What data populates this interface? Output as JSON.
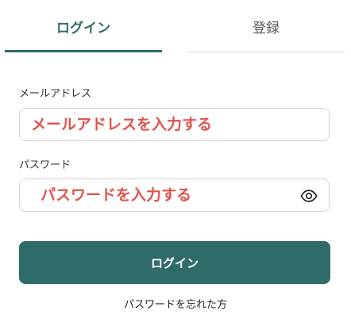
{
  "tabs": {
    "login": "ログイン",
    "register": "登録"
  },
  "email": {
    "label": "メールアドレス",
    "placeholder": "メールアドレスを入力する",
    "value": ""
  },
  "password": {
    "label": "パスワード",
    "placeholder": "パスワードを入力する",
    "value": "",
    "toggle_icon": "eye-icon"
  },
  "actions": {
    "login_button": "ログイン",
    "forgot_password": "パスワードを忘れた方"
  },
  "colors": {
    "accent": "#2f6b69",
    "placeholder": "#e0534a",
    "border": "#d4d4d4"
  }
}
